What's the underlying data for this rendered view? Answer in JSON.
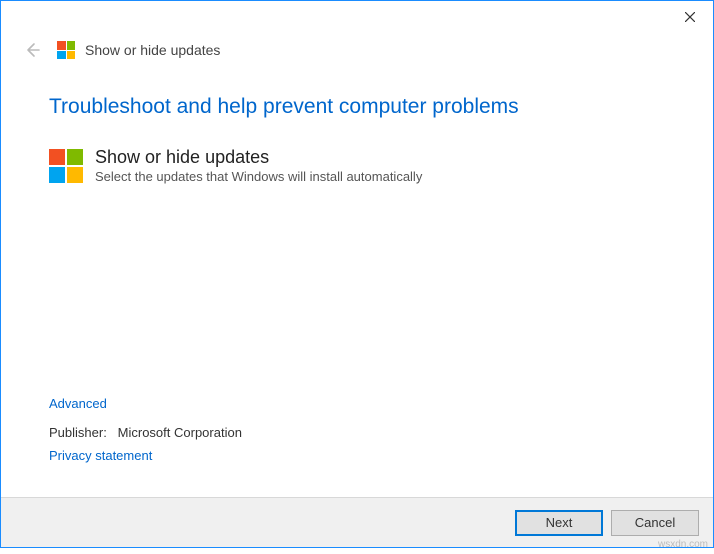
{
  "header": {
    "title": "Show or hide updates"
  },
  "main": {
    "heading": "Troubleshoot and help prevent computer problems",
    "option": {
      "title": "Show or hide updates",
      "description": "Select the updates that Windows will install automatically"
    }
  },
  "links": {
    "advanced": "Advanced",
    "privacy": "Privacy statement"
  },
  "publisher": {
    "label": "Publisher:",
    "value": "Microsoft Corporation"
  },
  "buttons": {
    "next": "Next",
    "cancel": "Cancel"
  },
  "watermark": "wsxdn.com"
}
